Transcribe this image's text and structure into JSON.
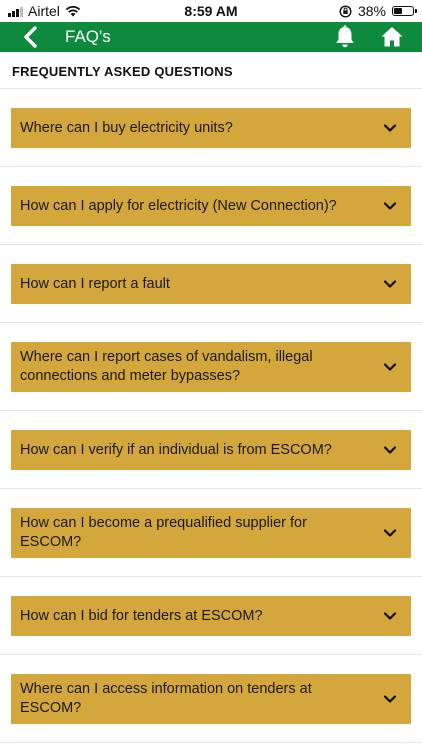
{
  "status_bar": {
    "carrier": "Airtel",
    "time": "8:59 AM",
    "battery_percent": "38%",
    "battery_level": 0.38,
    "icons": [
      "signal-icon",
      "wifi-icon",
      "orientation-lock-icon",
      "battery-icon"
    ]
  },
  "header": {
    "title": "FAQ's",
    "background_color": "#0e8a3c",
    "icons": [
      "back-icon",
      "bell-icon",
      "home-icon"
    ]
  },
  "section_title": "FREQUENTLY ASKED QUESTIONS",
  "faq_accent_color": "#d4a73c",
  "faqs": [
    {
      "question": "Where can I buy electricity units?"
    },
    {
      "question": "How can I apply for electricity (New Connection)?"
    },
    {
      "question": "How can I report a fault"
    },
    {
      "question": "Where can I report cases of vandalism, illegal connections and meter bypasses?"
    },
    {
      "question": "How can I verify if an individual is from ESCOM?"
    },
    {
      "question": "How can I become a prequalified supplier for ESCOM?"
    },
    {
      "question": "How can I bid for tenders at ESCOM?"
    },
    {
      "question": "Where can I access information on tenders at ESCOM?"
    }
  ]
}
